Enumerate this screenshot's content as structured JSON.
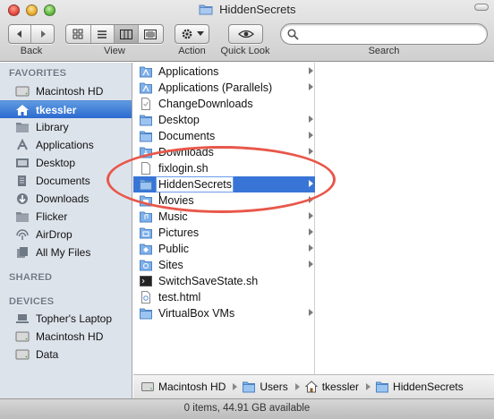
{
  "window": {
    "title": "HiddenSecrets"
  },
  "toolbar": {
    "back_label": "Back",
    "view_label": "View",
    "action_label": "Action",
    "quicklook_label": "Quick Look",
    "search_label": "Search",
    "search_value": "",
    "active_view": "columns"
  },
  "sidebar": {
    "favorites_header": "FAVORITES",
    "favorites": [
      {
        "label": "Macintosh HD",
        "icon": "hard-drive-icon"
      },
      {
        "label": "tkessler",
        "icon": "home-icon",
        "selected": true
      },
      {
        "label": "Library",
        "icon": "folder-icon"
      },
      {
        "label": "Applications",
        "icon": "applications-icon"
      },
      {
        "label": "Desktop",
        "icon": "desktop-icon"
      },
      {
        "label": "Documents",
        "icon": "documents-icon"
      },
      {
        "label": "Downloads",
        "icon": "downloads-icon"
      },
      {
        "label": "Flicker",
        "icon": "folder-icon"
      },
      {
        "label": "AirDrop",
        "icon": "airdrop-icon"
      },
      {
        "label": "All My Files",
        "icon": "all-files-icon"
      }
    ],
    "shared_header": "SHARED",
    "devices_header": "DEVICES",
    "devices": [
      {
        "label": "Topher's Laptop",
        "icon": "laptop-icon"
      },
      {
        "label": "Macintosh HD",
        "icon": "hard-drive-icon"
      },
      {
        "label": "Data",
        "icon": "hard-drive-icon"
      }
    ]
  },
  "column1": {
    "items": [
      {
        "label": "Applications",
        "icon": "applications-folder-icon",
        "folder": true
      },
      {
        "label": "Applications (Parallels)",
        "icon": "applications-folder-icon",
        "folder": true
      },
      {
        "label": "ChangeDownloads",
        "icon": "document-icon",
        "folder": false
      },
      {
        "label": "Desktop",
        "icon": "folder-icon",
        "folder": true
      },
      {
        "label": "Documents",
        "icon": "folder-icon",
        "folder": true
      },
      {
        "label": "Downloads",
        "icon": "downloads-folder-icon",
        "folder": true
      },
      {
        "label": "fixlogin.sh",
        "icon": "script-icon",
        "folder": false
      },
      {
        "label": "HiddenSecrets",
        "icon": "folder-icon",
        "folder": true,
        "selected": true,
        "renaming": true
      },
      {
        "label": "Movies",
        "icon": "movies-folder-icon",
        "folder": true
      },
      {
        "label": "Music",
        "icon": "music-folder-icon",
        "folder": true
      },
      {
        "label": "Pictures",
        "icon": "pictures-folder-icon",
        "folder": true
      },
      {
        "label": "Public",
        "icon": "public-folder-icon",
        "folder": true
      },
      {
        "label": "Sites",
        "icon": "sites-folder-icon",
        "folder": true
      },
      {
        "label": "SwitchSaveState.sh",
        "icon": "terminal-script-icon",
        "folder": false
      },
      {
        "label": "test.html",
        "icon": "html-document-icon",
        "folder": false
      },
      {
        "label": "VirtualBox VMs",
        "icon": "folder-icon",
        "folder": true
      }
    ]
  },
  "pathbar": {
    "crumbs": [
      {
        "label": "Macintosh HD",
        "icon": "hard-drive-icon"
      },
      {
        "label": "Users",
        "icon": "folder-icon"
      },
      {
        "label": "tkessler",
        "icon": "home-icon"
      },
      {
        "label": "HiddenSecrets",
        "icon": "folder-icon"
      }
    ]
  },
  "status": {
    "text": "0 items, 44.91 GB available"
  },
  "colors": {
    "selection": "#3875d7",
    "annotation": "#e8574a",
    "sidebar_bg": "#dde3eb"
  }
}
